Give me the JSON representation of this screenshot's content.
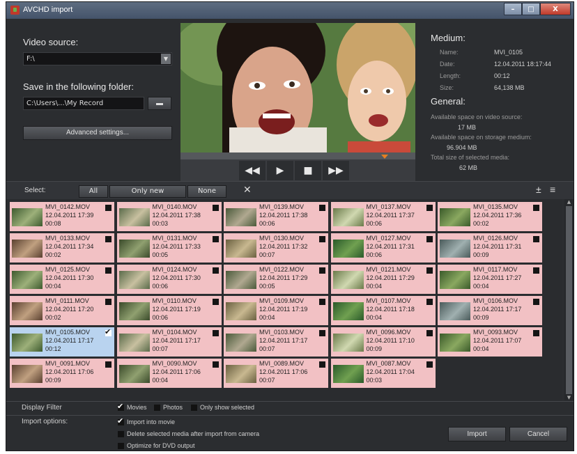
{
  "window": {
    "title": "AVCHD import",
    "min": "–",
    "max": "□",
    "close": "X"
  },
  "left": {
    "video_source_label": "Video source:",
    "video_source_value": "F:\\",
    "save_folder_label": "Save in the following folder:",
    "save_folder_value": "C:\\Users\\...\\My Record",
    "advanced_button": "Advanced settings..."
  },
  "medium": {
    "heading": "Medium:",
    "name_label": "Name:",
    "name": "MVI_0105",
    "date_label": "Date:",
    "date": "12.04.2011 18:17:44",
    "length_label": "Length:",
    "length": "00:12",
    "size_label": "Size:",
    "size": "64,138 MB"
  },
  "general": {
    "heading": "General:",
    "space_source_label": "Available space on video source:",
    "space_source": "17 MB",
    "space_storage_label": "Available space on storage medium:",
    "space_storage": "96.904 MB",
    "total_selected_label": "Total size of selected media:",
    "total_selected": "62 MB"
  },
  "player": {
    "rewind": "◀◀",
    "play": "▶",
    "stop": "■",
    "forward": "▶▶",
    "position_fraction": 0.87
  },
  "select": {
    "label": "Select:",
    "all": "All",
    "only_new": "Only new",
    "none": "None",
    "clear": "✕",
    "add": "±",
    "view": "≡"
  },
  "clips": [
    {
      "name": "MVI_0142.MOV",
      "date": "12.04.2011 17:39",
      "dur": "00:08",
      "checked": false
    },
    {
      "name": "MVI_0140.MOV",
      "date": "12.04.2011 17:38",
      "dur": "00:03",
      "checked": false
    },
    {
      "name": "MVI_0139.MOV",
      "date": "12.04.2011 17:38",
      "dur": "00:06",
      "checked": false
    },
    {
      "name": "MVI_0137.MOV",
      "date": "12.04.2011 17:37",
      "dur": "00:06",
      "checked": false
    },
    {
      "name": "MVI_0135.MOV",
      "date": "12.04.2011 17:36",
      "dur": "00:02",
      "checked": false
    },
    {
      "name": "MVI_0133.MOV",
      "date": "12.04.2011 17:34",
      "dur": "00:02",
      "checked": false
    },
    {
      "name": "MVI_0131.MOV",
      "date": "12.04.2011 17:33",
      "dur": "00:05",
      "checked": false
    },
    {
      "name": "MVI_0130.MOV",
      "date": "12.04.2011 17:32",
      "dur": "00:07",
      "checked": false
    },
    {
      "name": "MVI_0127.MOV",
      "date": "12.04.2011 17:31",
      "dur": "00:06",
      "checked": false
    },
    {
      "name": "MVI_0126.MOV",
      "date": "12.04.2011 17:31",
      "dur": "00:09",
      "checked": false
    },
    {
      "name": "MVI_0125.MOV",
      "date": "12.04.2011 17:30",
      "dur": "00:04",
      "checked": false
    },
    {
      "name": "MVI_0124.MOV",
      "date": "12.04.2011 17:30",
      "dur": "00:06",
      "checked": false
    },
    {
      "name": "MVI_0122.MOV",
      "date": "12.04.2011 17:29",
      "dur": "00:05",
      "checked": false
    },
    {
      "name": "MVI_0121.MOV",
      "date": "12.04.2011 17:29",
      "dur": "00:04",
      "checked": false
    },
    {
      "name": "MVI_0117.MOV",
      "date": "12.04.2011 17:27",
      "dur": "00:04",
      "checked": false
    },
    {
      "name": "MVI_0111.MOV",
      "date": "12.04.2011 17:20",
      "dur": "00:02",
      "checked": false
    },
    {
      "name": "MVI_0110.MOV",
      "date": "12.04.2011 17:19",
      "dur": "00:06",
      "checked": false
    },
    {
      "name": "MVI_0109.MOV",
      "date": "12.04.2011 17:19",
      "dur": "00:04",
      "checked": false
    },
    {
      "name": "MVI_0107.MOV",
      "date": "12.04.2011 17:18",
      "dur": "00:04",
      "checked": false
    },
    {
      "name": "MVI_0106.MOV",
      "date": "12.04.2011 17:17",
      "dur": "00:09",
      "checked": false
    },
    {
      "name": "MVI_0105.MOV",
      "date": "12.04.2011 17:17",
      "dur": "00:12",
      "checked": true
    },
    {
      "name": "MVI_0104.MOV",
      "date": "12.04.2011 17:17",
      "dur": "00:07",
      "checked": false
    },
    {
      "name": "MVI_0103.MOV",
      "date": "12.04.2011 17:17",
      "dur": "00:07",
      "checked": false
    },
    {
      "name": "MVI_0096.MOV",
      "date": "12.04.2011 17:10",
      "dur": "00:09",
      "checked": false
    },
    {
      "name": "MVI_0093.MOV",
      "date": "12.04.2011 17:07",
      "dur": "00:04",
      "checked": false
    },
    {
      "name": "MVI_0091.MOV",
      "date": "12.04.2011 17:06",
      "dur": "00:09",
      "checked": false
    },
    {
      "name": "MVI_0090.MOV",
      "date": "12.04.2011 17:06",
      "dur": "00:04",
      "checked": false
    },
    {
      "name": "MVI_0089.MOV",
      "date": "12.04.2011 17:06",
      "dur": "00:07",
      "checked": false
    },
    {
      "name": "MVI_0087.MOV",
      "date": "12.04.2011 17:04",
      "dur": "00:03",
      "checked": false
    }
  ],
  "filter": {
    "label": "Display Filter",
    "movies": "Movies",
    "photos": "Photos",
    "only_selected": "Only show selected"
  },
  "import_options": {
    "label": "Import options:",
    "into_movie": "Import into movie",
    "delete_after": "Delete selected media after import from camera",
    "optimize_dvd": "Optimize for DVD output"
  },
  "actions": {
    "import": "Import",
    "cancel": "Cancel"
  },
  "colors": {
    "card": "#f2c1c4",
    "card_selected": "#b9d3ef",
    "accent": "#e67e22"
  }
}
